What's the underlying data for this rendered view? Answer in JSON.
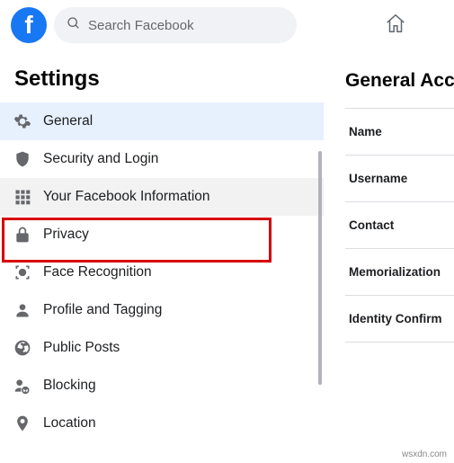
{
  "search": {
    "placeholder": "Search Facebook"
  },
  "sidebar": {
    "title": "Settings",
    "items": [
      {
        "label": "General"
      },
      {
        "label": "Security and Login"
      },
      {
        "label": "Your Facebook Information"
      },
      {
        "label": "Privacy"
      },
      {
        "label": "Face Recognition"
      },
      {
        "label": "Profile and Tagging"
      },
      {
        "label": "Public Posts"
      },
      {
        "label": "Blocking"
      },
      {
        "label": "Location"
      }
    ]
  },
  "main": {
    "title": "General Acco",
    "rows": [
      {
        "label": "Name"
      },
      {
        "label": "Username"
      },
      {
        "label": "Contact"
      },
      {
        "label": "Memorialization"
      },
      {
        "label": "Identity Confirm"
      }
    ]
  },
  "attribution": "wsxdn.com"
}
